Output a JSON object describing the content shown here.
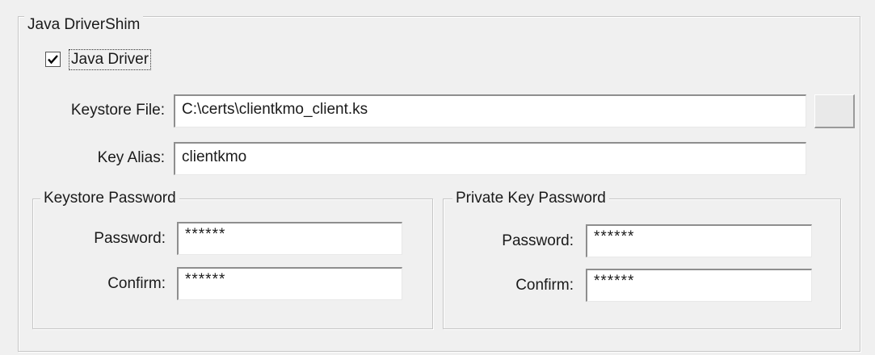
{
  "main_group": {
    "title": "Java DriverShim"
  },
  "java_driver": {
    "label": "Java Driver",
    "checked": true
  },
  "keystore_file": {
    "label": "Keystore File:",
    "value": "C:\\certs\\clientkmo_client.ks"
  },
  "browse_button": {
    "label": ""
  },
  "key_alias": {
    "label": "Key Alias:",
    "value": "clientkmo"
  },
  "keystore_password": {
    "title": "Keystore Password",
    "password_label": "Password:",
    "password_value": "******",
    "confirm_label": "Confirm:",
    "confirm_value": "******"
  },
  "private_key_password": {
    "title": "Private Key Password",
    "password_label": "Password:",
    "password_value": "******",
    "confirm_label": "Confirm:",
    "confirm_value": "******"
  }
}
